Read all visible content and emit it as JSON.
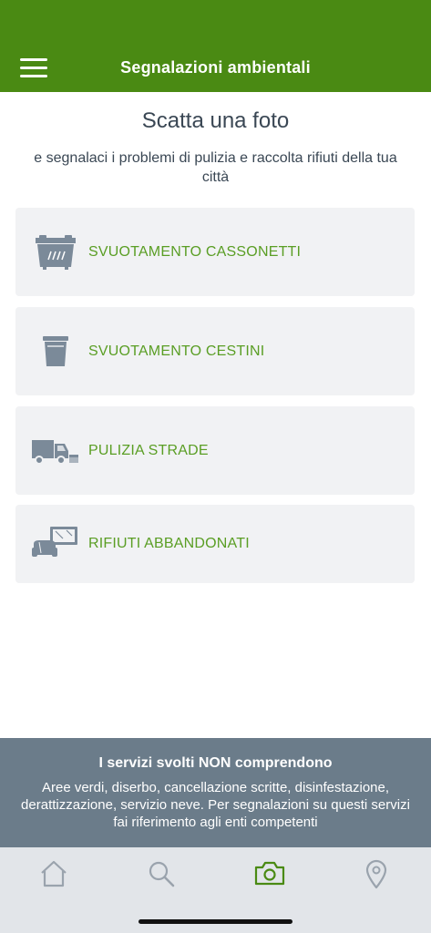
{
  "header": {
    "title": "Segnalazioni ambientali",
    "menu_icon": "hamburger-menu-icon",
    "background": "#4a8a13"
  },
  "intro": {
    "heading": "Scatta una foto",
    "subheading": "e segnalaci i problemi di pulizia e raccolta rifiuti della tua città"
  },
  "categories": [
    {
      "label": "SVUOTAMENTO CASSONETTI",
      "icon": "dumpster-icon"
    },
    {
      "label": "SVUOTAMENTO CESTINI",
      "icon": "trash-bin-icon"
    },
    {
      "label": "PULIZIA STRADE",
      "icon": "street-sweeper-truck-icon"
    },
    {
      "label": "RIFIUTI ABBANDONATI",
      "icon": "abandoned-waste-icon"
    }
  ],
  "notice": {
    "title": "I servizi svolti NON comprendono",
    "text": "Aree verdi, diserbo, cancellazione scritte, disinfestazione, derattizzazione, servizio neve. Per segnalazioni su questi servizi fai riferimento agli enti competenti"
  },
  "tabs": [
    {
      "icon": "home-icon",
      "active": false
    },
    {
      "icon": "search-icon",
      "active": false
    },
    {
      "icon": "camera-icon",
      "active": true
    },
    {
      "icon": "location-pin-icon",
      "active": false
    }
  ],
  "colors": {
    "accent": "#5a9e24",
    "icon_gray": "#7b8a99",
    "card_bg": "#f1f2f4",
    "notice_bg": "#6b7c8a",
    "tab_inactive": "#9aa3ad"
  }
}
